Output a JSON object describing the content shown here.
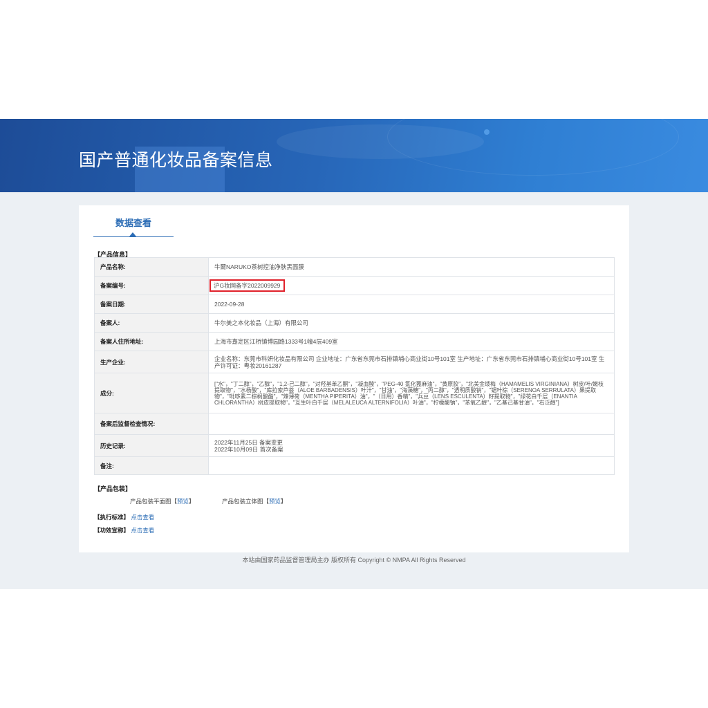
{
  "banner": {
    "title": "国产普通化妆品备案信息"
  },
  "tab": {
    "label": "数据查看"
  },
  "product_info": {
    "section_label": "【产品信息】",
    "rows": [
      {
        "label": "产品名称:",
        "value": "牛爾NARUKO茶树控油净肤黑面膜"
      },
      {
        "label": "备案编号:",
        "value": "沪G妆网备字2022009929"
      },
      {
        "label": "备案日期:",
        "value": "2022-09-28"
      },
      {
        "label": "备案人:",
        "value": "牛尔美之本化妆品（上海）有限公司"
      },
      {
        "label": "备案人住所地址:",
        "value": "上海市嘉定区江桥镇博园路1333号1幢4层409室"
      },
      {
        "label": "生产企业:",
        "value": "企业名称：东莞市科妍化妆品有限公司 企业地址：广东省东莞市石排镇埔心商业街10号101室 生产地址：广东省东莞市石排镇埔心商业街10号101室 生产许可证：粤妆20161287"
      },
      {
        "label": "成分:",
        "value": "[\"水\"，\"丁二醇\"，\"乙醇\"，\"1,2-己二醇\"，\"对羟基苯乙酮\"，\"凝血酸\"，\"PEG-40 氢化蓖麻油\"，\"黄原胶\"，\"北美金缕梅（HAMAMELIS VIRGINIANA）树皮/叶/嫩枝提取物\"，\"水杨酸\"，\"库拉索芦荟（ALOE BARBADENSIS）叶汁\"，\"甘油\"，\"海藻糖\"，\"丙二醇\"，\"透明质酸钠\"，\"锯叶棕（SERENOA SERRULATA）果提取物\"，\"吡哆素二棕榈酸酯\"，\"辣薄荷（MENTHA PIPERITA）油\"，\"（日用）香精\"，\"兵豆（LENS ESCULENTA）籽提取物\"，\"绿花白千层（ENANTIA CHLORANTHA）树皮提取物\"，\"互生叶白千层（MELALEUCA ALTERNIFOLIA）叶油\"，\"柠檬酸钠\"，\"苯氧乙醇\"，\"乙基己基甘油\"，\"右泛醇\"]"
      },
      {
        "label": "备案后监督检查情况:",
        "value": ""
      },
      {
        "label": "历史记录:",
        "value": "2022年11月25日 备案变更\n2022年10月09日 首次备案"
      },
      {
        "label": "备注:",
        "value": ""
      }
    ]
  },
  "packaging": {
    "section_label": "【产品包装】",
    "flat_label": "产品包装平面图",
    "solid_label": "产品包装立体图",
    "preview_link": "预览",
    "bracket_open": "【",
    "bracket_close": "】"
  },
  "standard": {
    "label": "【执行标准】",
    "link": "点击查看"
  },
  "efficacy": {
    "label": "【功效宣称】",
    "link": "点击查看"
  },
  "footer": {
    "text": "本站由国家药品监督管理局主办 版权所有 Copyright © NMPA All Rights Reserved"
  },
  "colors": {
    "banner": "#2766b8",
    "accent": "#2b6cb5",
    "highlight_box": "#e0202a",
    "background": "#ecf0f4"
  }
}
